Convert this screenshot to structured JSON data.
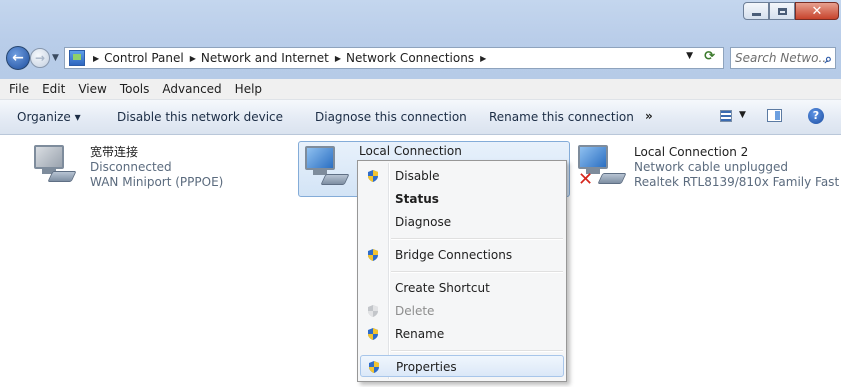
{
  "window": {
    "caption": {
      "minimize": "minimize",
      "maximize": "maximize",
      "close": "close"
    }
  },
  "address_bar": {
    "breadcrumbs": [
      "Control Panel",
      "Network and Internet",
      "Network Connections"
    ],
    "search_placeholder": "Search Netwo..."
  },
  "menubar": {
    "items": [
      "File",
      "Edit",
      "View",
      "Tools",
      "Advanced",
      "Help"
    ]
  },
  "commandbar": {
    "organize": "Organize ▾",
    "disable": "Disable this network device",
    "diagnose": "Diagnose this connection",
    "rename": "Rename this connection",
    "more": "»"
  },
  "connections": [
    {
      "name": "宽带连接",
      "status": "Disconnected",
      "device": "WAN Miniport (PPPOE)"
    },
    {
      "name": "Local Connection",
      "status": "",
      "device": ""
    },
    {
      "name": "Local Connection 2",
      "status": "Network cable unplugged",
      "device": "Realtek RTL8139/810x Family Fast ..."
    }
  ],
  "context_menu": {
    "items": [
      {
        "label": "Disable",
        "shield": true,
        "bold": false,
        "disabled": false
      },
      {
        "label": "Status",
        "shield": false,
        "bold": true,
        "disabled": false
      },
      {
        "label": "Diagnose",
        "shield": false,
        "bold": false,
        "disabled": false
      },
      {
        "label": "Bridge Connections",
        "shield": true,
        "bold": false,
        "disabled": false
      },
      {
        "label": "Create Shortcut",
        "shield": false,
        "bold": false,
        "disabled": false
      },
      {
        "label": "Delete",
        "shield": true,
        "bold": false,
        "disabled": true
      },
      {
        "label": "Rename",
        "shield": true,
        "bold": false,
        "disabled": false
      },
      {
        "label": "Properties",
        "shield": true,
        "bold": false,
        "disabled": false,
        "highlighted": true
      }
    ]
  },
  "colors": {
    "accent": "#2b6fc2",
    "error": "#d6241b"
  }
}
